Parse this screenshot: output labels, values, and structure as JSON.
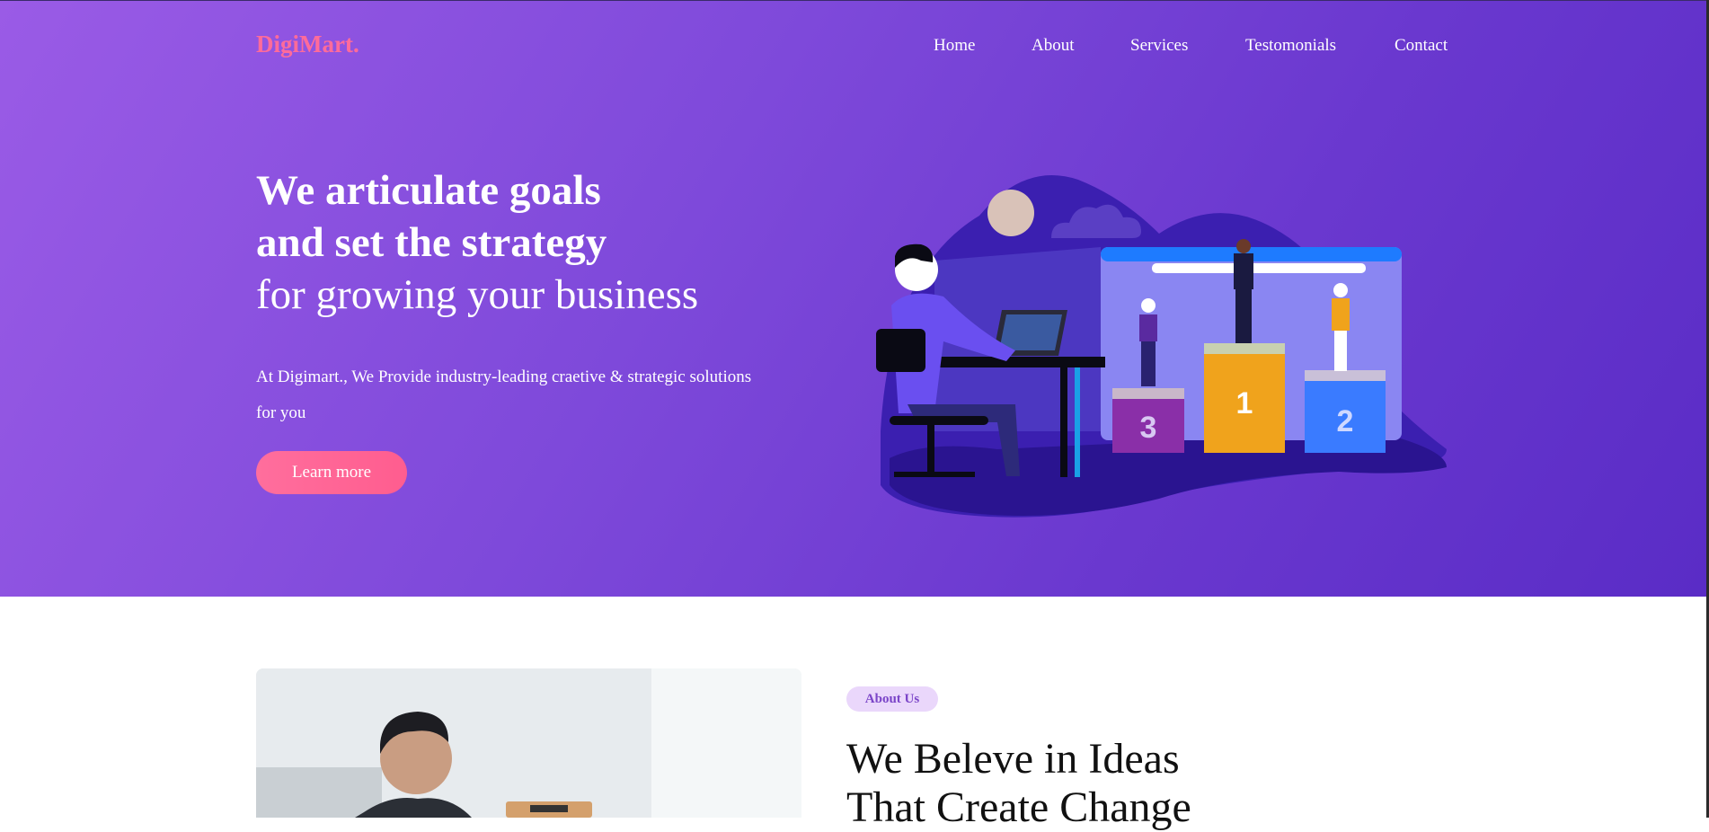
{
  "brand": {
    "logo": "DigiMart."
  },
  "nav": {
    "items": [
      "Home",
      "About",
      "Services",
      "Testomonials",
      "Contact"
    ]
  },
  "hero": {
    "title_line1": "We articulate goals",
    "title_line2": "and set the strategy",
    "title_line3": "for growing your business",
    "subtitle": "At Digimart., We Provide industry-leading craetive & strategic solutions for you",
    "cta": "Learn more",
    "podium_labels": [
      "3",
      "1",
      "2"
    ]
  },
  "about": {
    "badge": "About Us",
    "title_line1": "We Beleve in Ideas",
    "title_line2": "That Create Change"
  },
  "colors": {
    "hero_gradient_start": "#9a5be6",
    "hero_gradient_end": "#5a2cc6",
    "accent_pink": "#ff6b9a",
    "badge_bg": "#ead7fb",
    "badge_text": "#7b45c8"
  },
  "icons": [
    "hero-illustration",
    "about-photo"
  ]
}
